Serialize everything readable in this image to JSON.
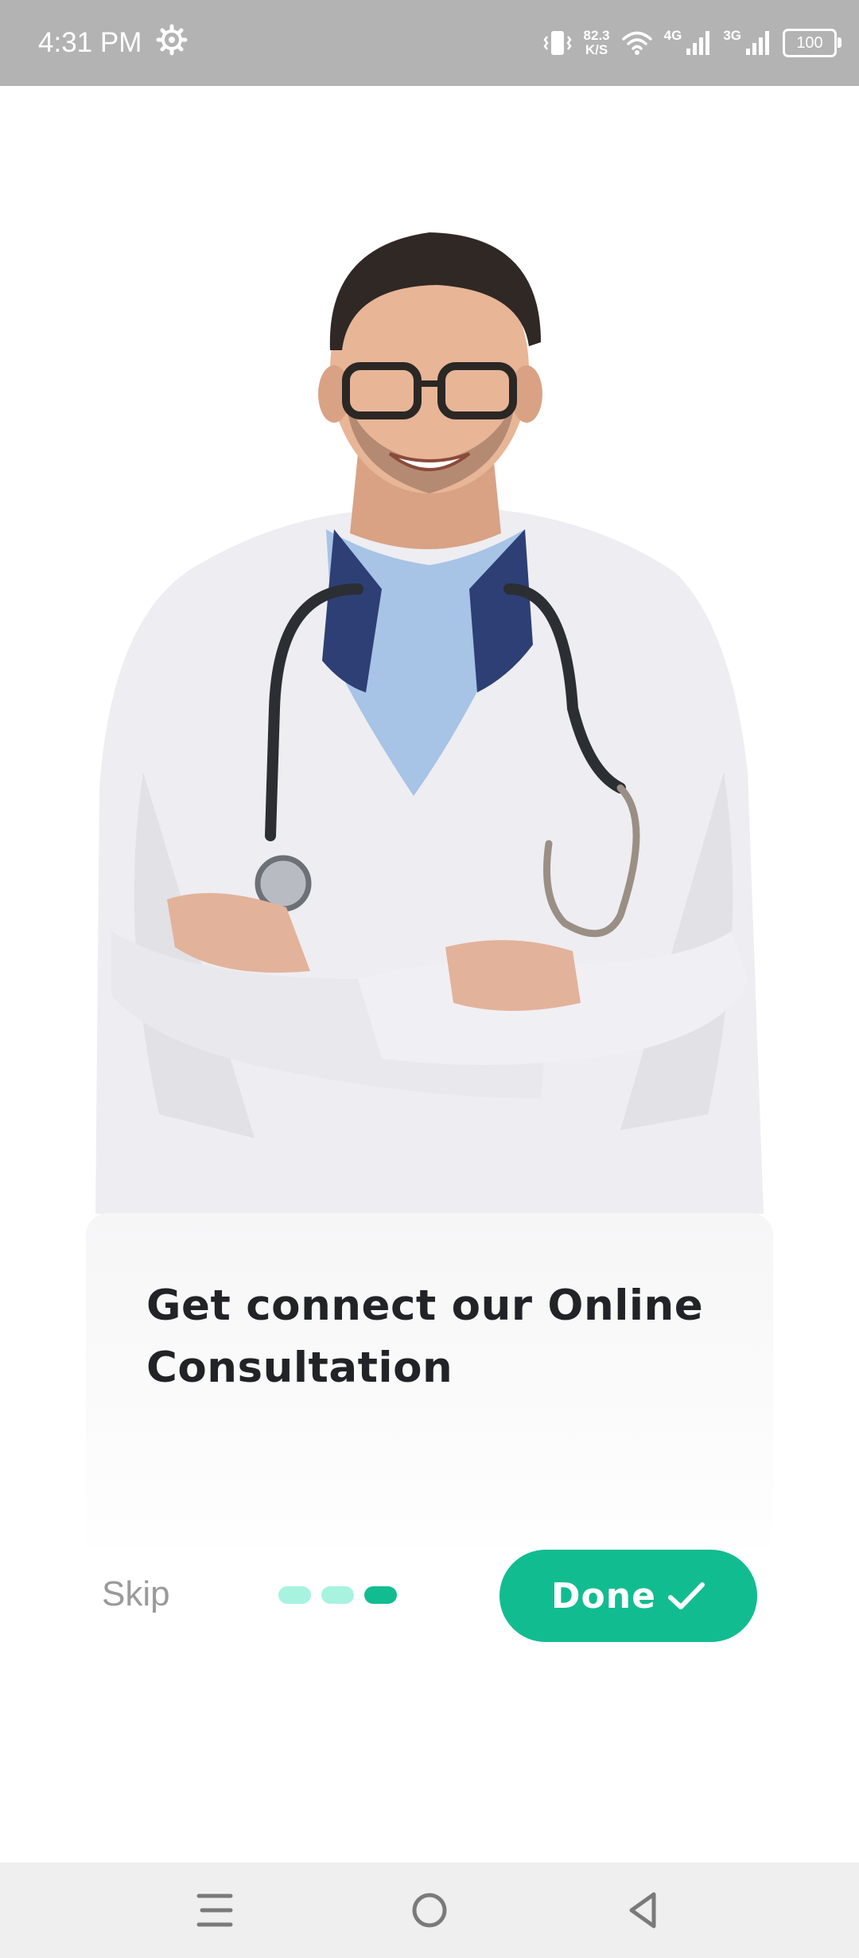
{
  "status_bar": {
    "time": "4:31 PM",
    "speed_value": "82.3",
    "speed_unit": "K/S",
    "net1": "4G",
    "net2": "3G",
    "battery": "100",
    "icons": [
      "gear-icon",
      "vibrate-icon",
      "wifi-icon",
      "signal-icon",
      "signal-icon",
      "battery-icon"
    ]
  },
  "onboarding": {
    "title": "Get connect our Online Consultation",
    "skip_label": "Skip",
    "done_label": "Done",
    "page_index": 3,
    "page_count": 3
  },
  "colors": {
    "accent": "#12bc91",
    "dot_inactive": "#a7f3e0",
    "status_bar_bg": "#b3b3b3",
    "title": "#222326",
    "skip": "#9a9a9a"
  },
  "nav_bar": {
    "icons": [
      "menu-icon",
      "home-icon",
      "back-icon"
    ]
  }
}
